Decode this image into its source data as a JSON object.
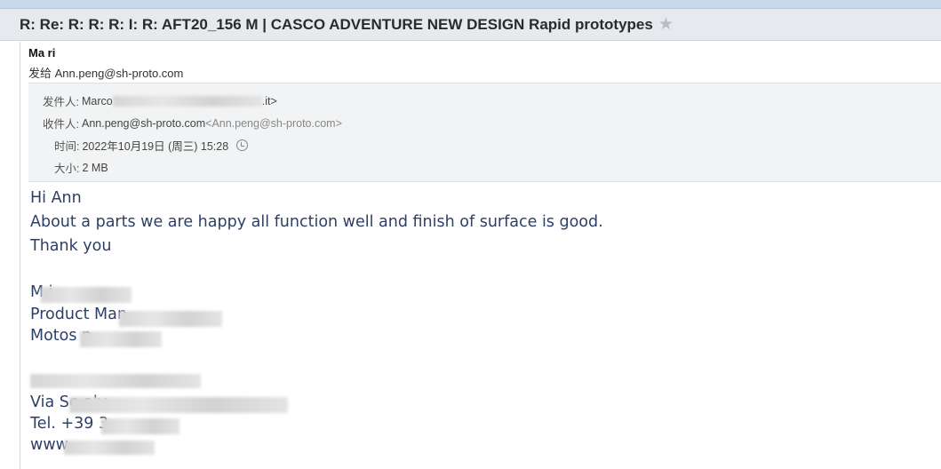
{
  "subject": "R: Re: R: R: R: I: R: AFT20_156 M | CASCO ADVENTURE NEW DESIGN  Rapid prototypes",
  "icons": {
    "star": "star-icon",
    "history": "clock-history-icon"
  },
  "header": {
    "sender_name": "Ma          ri",
    "sent_to_label": "发给",
    "sent_to": "Ann.peng@sh-proto.com"
  },
  "meta": {
    "from_label": "发件人:",
    "from_value_start": "Marco",
    "from_value_end": ".it>",
    "to_label": "收件人:",
    "to_address": "Ann.peng@sh-proto.com",
    "to_bracket": "<Ann.peng@sh-proto.com>",
    "time_label": "时间:",
    "time_value": "2022年10月19日 (周三) 15:28",
    "size_label": "大小:",
    "size_value": "2 MB"
  },
  "body": {
    "greeting": "Hi Ann",
    "message": "About a parts we are happy all function well and finish of surface is good.",
    "thanks": "Thank you",
    "sig_name": "M          i",
    "sig_title": "Product Man",
    "sig_company": "Motos          n",
    "addr_line": "Via Se                                        aly",
    "tel_line": "Tel. +39 3",
    "web_line": "www"
  }
}
